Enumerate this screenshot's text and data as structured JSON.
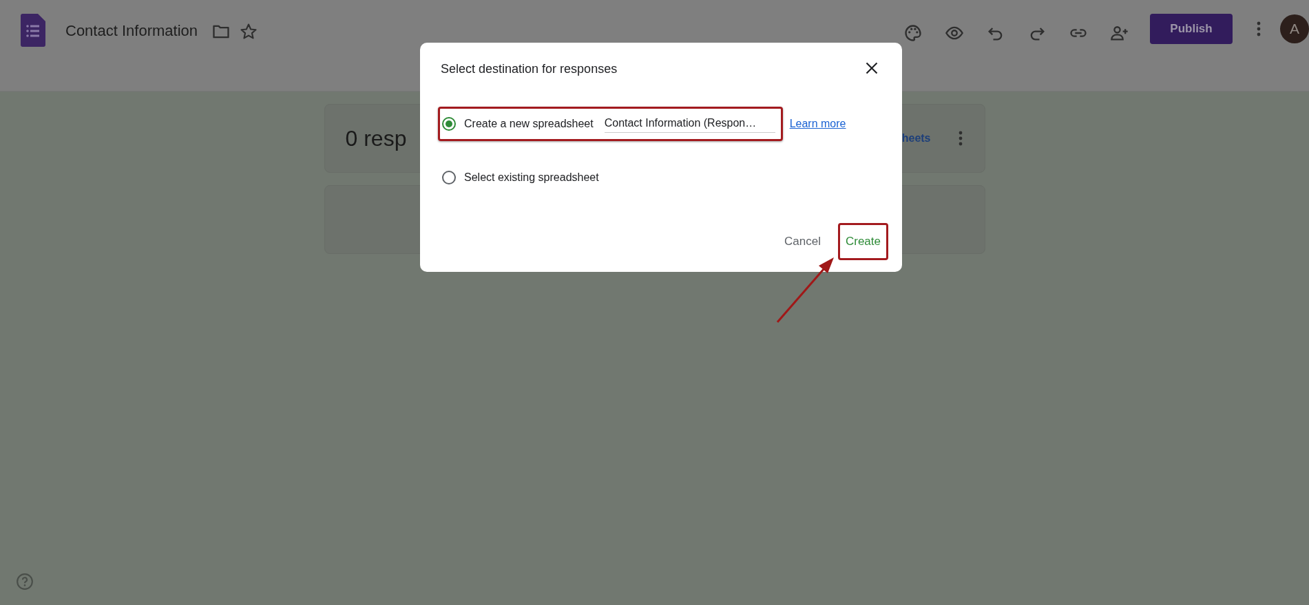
{
  "app": {
    "title": "Contact Information",
    "publish": "Publish",
    "avatar": "A"
  },
  "responses": {
    "count_text": "0 resp",
    "link_text": "heets"
  },
  "dialog": {
    "title": "Select destination for responses",
    "options": [
      {
        "label": "Create a new spreadsheet",
        "selected": true,
        "highlighted": true,
        "value": "Contact Information (Respon…"
      },
      {
        "label": "Select existing spreadsheet",
        "selected": false,
        "highlighted": false
      }
    ],
    "learn_more": "Learn more",
    "buttons": [
      {
        "label": "Cancel",
        "kind": "secondary",
        "highlighted": false
      },
      {
        "label": "Create",
        "kind": "primary",
        "highlighted": true
      }
    ]
  }
}
